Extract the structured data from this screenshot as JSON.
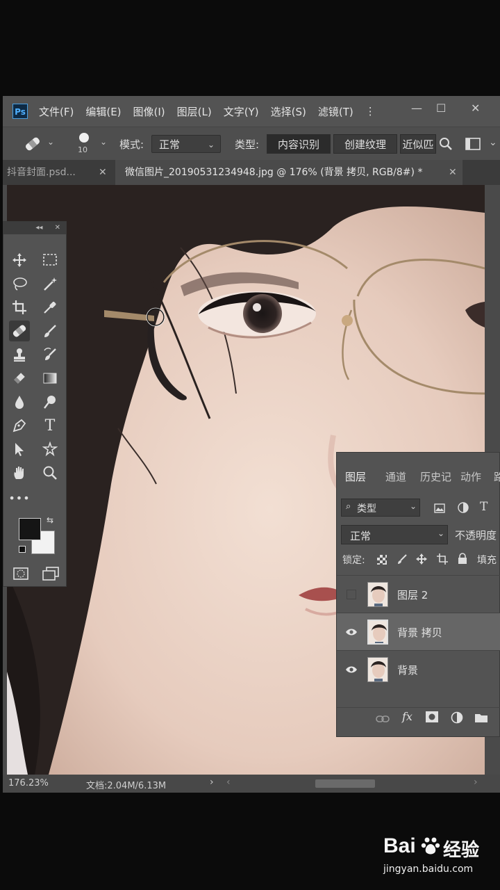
{
  "app": {
    "logo": "Ps"
  },
  "menu": [
    "文件(F)",
    "编辑(E)",
    "图像(I)",
    "图层(L)",
    "文字(Y)",
    "选择(S)",
    "滤镜(T)",
    "⋮"
  ],
  "window_controls": {
    "minimize": "—",
    "restore": "☐",
    "close": "✕"
  },
  "options": {
    "brush_size": "10",
    "mode_label": "模式:",
    "mode_value": "正常",
    "type_label": "类型:",
    "type_buttons": [
      "内容识别",
      "创建纹理",
      "近似匹"
    ]
  },
  "tabs": [
    {
      "label": "抖音封面.psd...",
      "active": false
    },
    {
      "label": "微信图片_20190531234948.jpg @ 176% (背景 拷贝, RGB/8#) *",
      "active": true
    }
  ],
  "status": {
    "zoom": "176.23%",
    "doc_info": "文档:2.04M/6.13M"
  },
  "toolbox": {
    "collapse": "◂◂",
    "close": "✕",
    "tools": [
      "move-icon",
      "marquee-icon",
      "lasso-icon",
      "magic-wand-icon",
      "crop-icon",
      "eyedropper-icon",
      "healing-brush-icon",
      "brush-icon",
      "stamp-icon",
      "history-brush-icon",
      "eraser-icon",
      "gradient-icon",
      "blur-icon",
      "dodge-icon",
      "pen-icon",
      "type-icon",
      "path-select-icon",
      "shape-icon",
      "hand-icon",
      "zoom-icon",
      "more-icon"
    ],
    "foreground_color": "#151515",
    "background_color": "#f2f2f2"
  },
  "layers_panel": {
    "tabs": [
      "图层",
      "通道",
      "历史记",
      "动作",
      "路"
    ],
    "filter_label": "类型",
    "blend_mode": "正常",
    "opacity_label": "不透明度",
    "lock_label": "锁定:",
    "fill_label": "填充",
    "layers": [
      {
        "name": "图层 2",
        "visible": false,
        "selected": false
      },
      {
        "name": "背景 拷贝",
        "visible": true,
        "selected": true
      },
      {
        "name": "背景",
        "visible": true,
        "selected": false
      }
    ]
  },
  "watermark": {
    "brand": "Bai",
    "brand2": "经验",
    "url": "jingyan.baidu.com"
  }
}
